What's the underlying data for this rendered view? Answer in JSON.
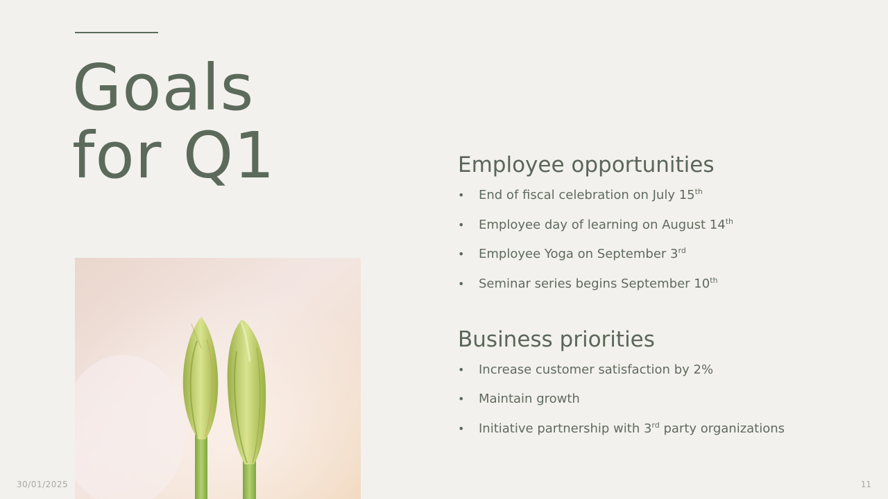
{
  "slide": {
    "title_line1": "Goals",
    "title_line2": "for Q1",
    "date": "30/01/2025",
    "page_number": "11"
  },
  "sections": {
    "employee": {
      "heading": "Employee opportunities",
      "items": [
        {
          "text": "End of fiscal celebration on July 15",
          "suffix": "th"
        },
        {
          "text": "Employee day of learning on August 14",
          "suffix": "th"
        },
        {
          "text": "Employee Yoga on September 3",
          "suffix": "rd"
        },
        {
          "text": "Seminar series begins September 10",
          "suffix": "th"
        }
      ]
    },
    "business": {
      "heading": "Business priorities",
      "items": [
        {
          "text": "Increase customer satisfaction by 2%"
        },
        {
          "text": "Maintain growth"
        },
        {
          "text_before": "Initiative partnership with 3",
          "suffix": "rd",
          "text_after": " party organizations"
        }
      ]
    }
  },
  "colors": {
    "background": "#f3f1ed",
    "title": "#5b6a5a",
    "body": "#5f6a5e",
    "footer": "#a7a9a3"
  }
}
